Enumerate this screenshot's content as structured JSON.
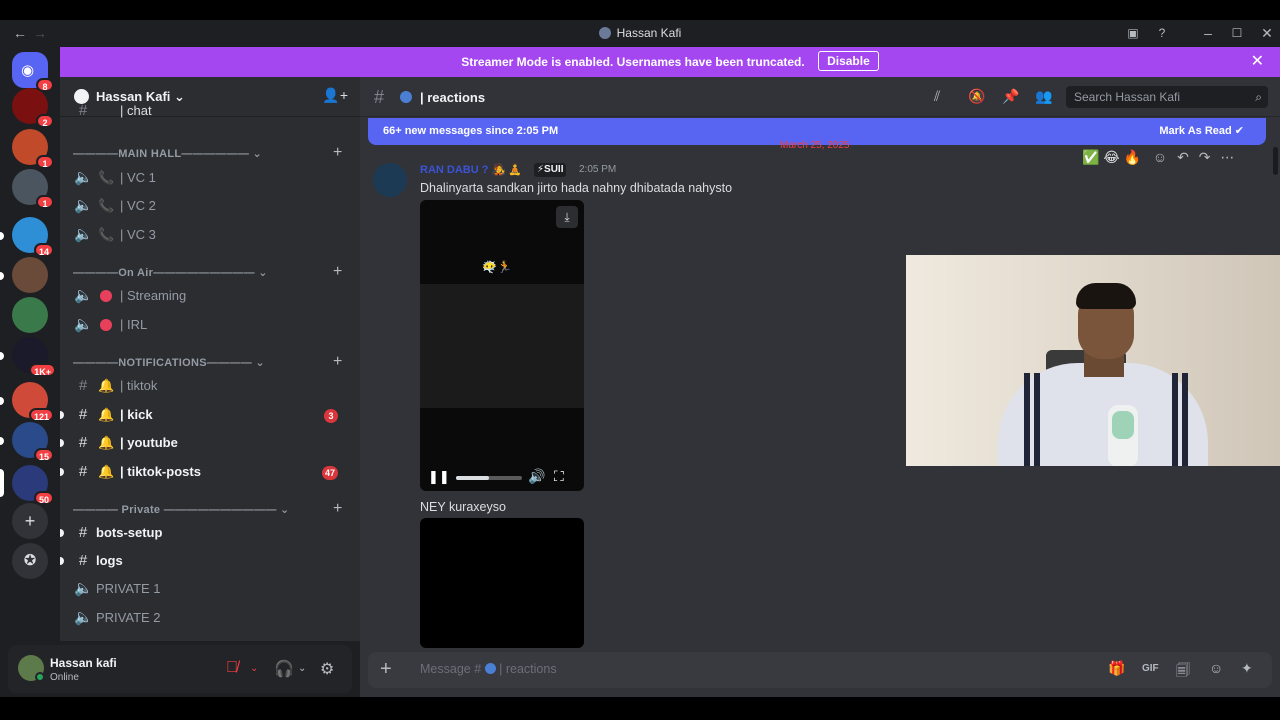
{
  "window": {
    "title": "Hassan Kafi"
  },
  "servers": [
    {
      "badge": "8",
      "color": "#5865f2"
    },
    {
      "badge": "2",
      "color": "#7a1010"
    },
    {
      "badge": "1",
      "color": "#c04a2a"
    },
    {
      "badge": "1",
      "color": "#4a5560"
    },
    {
      "badge": "14",
      "color": "#2f8fd6"
    },
    {
      "badge": "",
      "color": "#6a4b3a"
    },
    {
      "badge": "",
      "color": "#3a7a4a"
    },
    {
      "badge": "1K+",
      "color": "#1a1a2a"
    },
    {
      "badge": "121",
      "color": "#d04a3a"
    },
    {
      "badge": "15",
      "color": "#2a4a8a"
    },
    {
      "badge": "50",
      "color": "#2a3a7a"
    }
  ],
  "banner": {
    "text": "Streamer Mode is enabled. Usernames have been truncated.",
    "button": "Disable"
  },
  "guild": {
    "name": "Hassan Kafi"
  },
  "categories": {
    "main_hall": "————MAIN HALL——————",
    "on_air": "————On Air—————————",
    "notifications": "————NOTIFICATIONS————",
    "private": "———— Private ——————————"
  },
  "channels": {
    "chat": "| chat",
    "vc1": "| VC 1",
    "vc2": "| VC 2",
    "vc3": "| VC 3",
    "streaming": "| Streaming",
    "irl": "| IRL",
    "tiktok": "| tiktok",
    "kick": "| kick",
    "kick_badge": "3",
    "youtube": "| youtube",
    "tiktok_posts": "| tiktok-posts",
    "tiktok_posts_badge": "47",
    "bots_setup": "bots-setup",
    "logs": "logs",
    "private1": "PRIVATE 1",
    "private2": "PRIVATE 2"
  },
  "user": {
    "name": "Hassan kafi",
    "status": "Online"
  },
  "channel_header": {
    "title": "| reactions",
    "search_placeholder": "Search Hassan Kafi"
  },
  "newbar": {
    "text": "66+ new messages since 2:05 PM",
    "action": "Mark As Read"
  },
  "date_divider": "March 25, 2025",
  "message": {
    "author": "RAN DABU ?",
    "tag": "⚡SUII",
    "time": "2:05 PM",
    "text": "Dhalinyarta sandkan jirto hada nahny dhibatada nahysto",
    "reactions": [
      "✅",
      "😂",
      "🔥"
    ],
    "video_progress": 0.5
  },
  "message2": {
    "text": "NEY kuraxeyso"
  },
  "composer": {
    "placeholder": "Message #",
    "channel": "| reactions"
  }
}
